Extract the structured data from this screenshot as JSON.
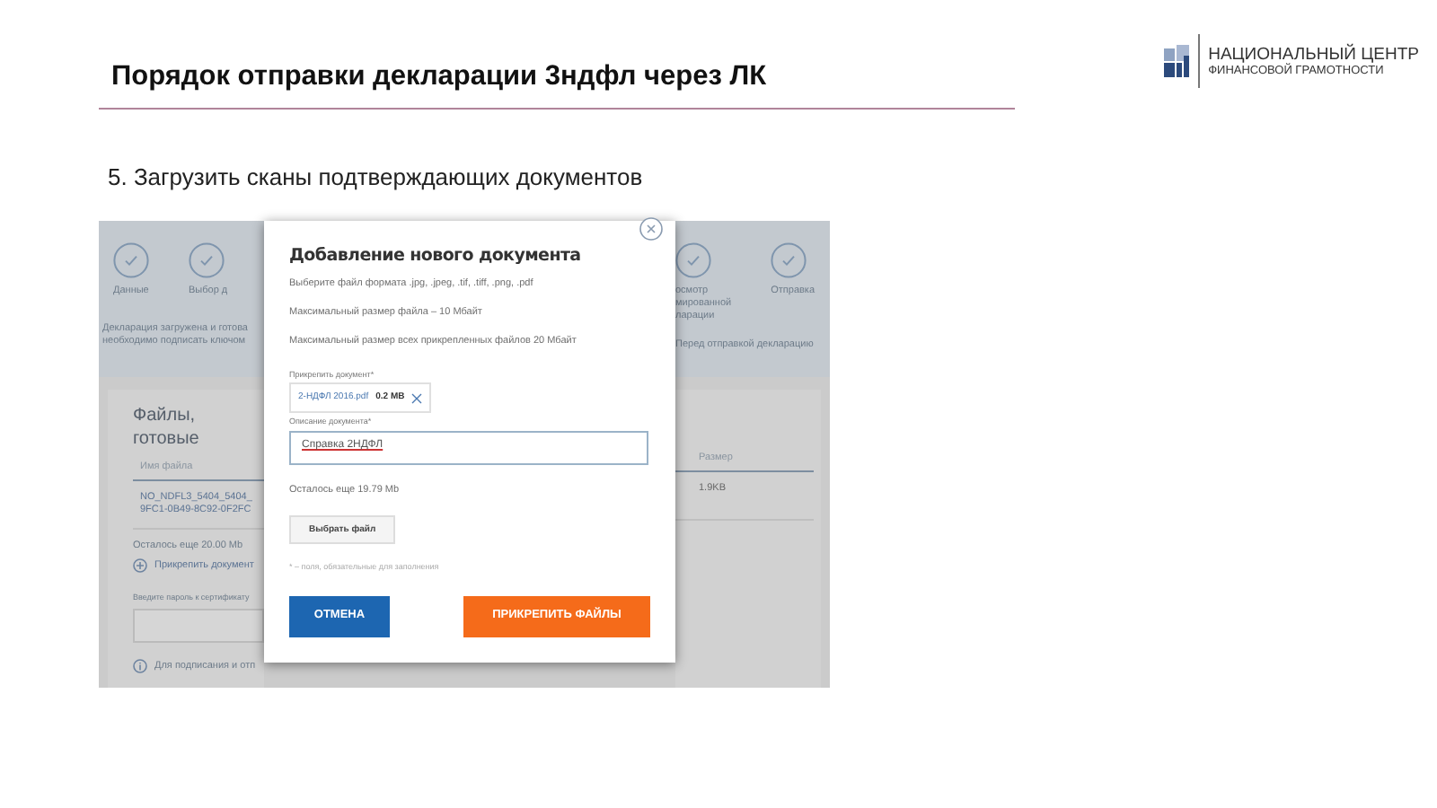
{
  "slide": {
    "title": "Порядок отправки декларации 3ндфл через ЛК",
    "subtitle": "5. Загрузить сканы подтверждающих документов"
  },
  "logo": {
    "line_1": "НАЦИОНАЛЬНЫЙ ЦЕНТР",
    "line_2": "ФИНАНСОВОЙ ГРАМОТНОСТИ"
  },
  "screenshot": {
    "left": {
      "steps": [
        {
          "label": "Данные"
        },
        {
          "label": "Выбор д"
        }
      ],
      "notice": "Декларация загружена и готова\nнеобходимо подписать ключом",
      "card_title": "Файлы, готовые",
      "column_header": "Имя файла",
      "file_name": "NO_NDFL3_5404_5404_\n9FC1-0B49-8C92-0F2FC",
      "remaining": "Осталось еще 20.00 Mb",
      "attach_link": "Прикрепить документ",
      "password_label": "Введите пароль к сертификату",
      "sign_note": "Для подписания и отп"
    },
    "right": {
      "steps": [
        {
          "label": "осмотр\nмированной\nларации"
        },
        {
          "label": "Отправка"
        }
      ],
      "notice": "Перед отправкой декларацию",
      "column_header": "Размер",
      "file_size": "1.9KB"
    },
    "modal": {
      "title": "Добавление нового документа",
      "hints": [
        "Выберите файл формата .jpg, .jpeg, .tif, .tiff, .png, .pdf",
        "Максимальный размер файла – 10 Мбайт",
        "Максимальный размер всех прикрепленных файлов 20 Мбайт"
      ],
      "attach_label": "Прикрепить документ*",
      "file": {
        "name": "2-НДФЛ 2016.pdf",
        "size": "0.2 MB"
      },
      "description_label": "Описание документа*",
      "description_value": "Справка 2НДФЛ",
      "remaining": "Осталось еще 19.79 Mb",
      "choose_button": "Выбрать файл",
      "required_note": "* – поля, обязательные для заполнения",
      "cancel_button": "ОТМЕНА",
      "attach_button": "ПРИКРЕПИТЬ ФАЙЛЫ"
    }
  }
}
